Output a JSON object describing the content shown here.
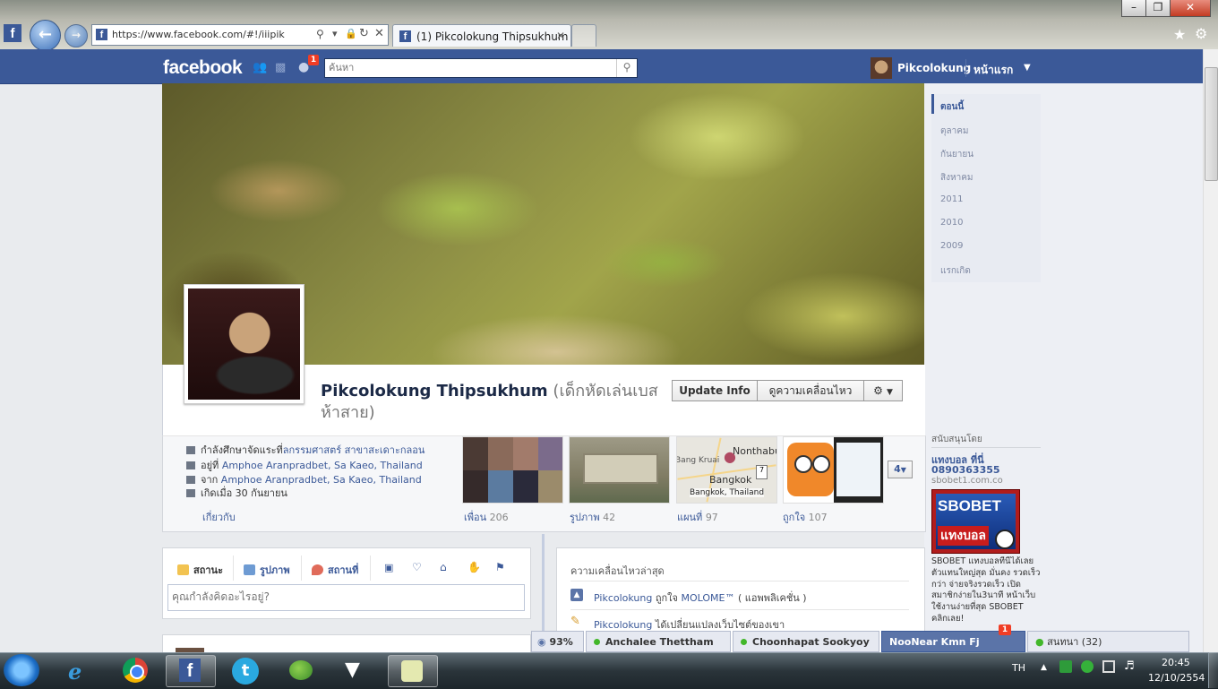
{
  "browser": {
    "address": "https://www.facebook.com/#!/iiipik",
    "tab_title": "(1) Pikcolokung Thipsukhum"
  },
  "topbar": {
    "logo": "facebook",
    "notification_count": "1",
    "search_placeholder": "ค้นหา",
    "user_name": "Pikcolokung",
    "home_label": "หน้าแรก"
  },
  "profile": {
    "name": "Pikcolokung Thipsukhum",
    "nickname": "(เด็กหัดเล่นเบสห้าสาย)",
    "update_info_label": "Update Info",
    "activity_label": "ดูความเคลื่อนไหว"
  },
  "info": {
    "study": "กำลังศึกษาจัดแระที่",
    "study_link": "ลกรรมศาสตร์ สาขาสะเดาะกลอน",
    "lives_prefix": "อยู่ที่",
    "lives": "Amphoe Aranpradbet, Sa Kaeo, Thailand",
    "from_prefix": "จาก",
    "from": "Amphoe Aranpradbet, Sa Kaeo, Thailand",
    "birthday": "เกิดเมื่อ 30 กันยายน",
    "about_link": "เกี่ยวกับ"
  },
  "tiles": [
    {
      "label": "เพื่อน",
      "count": "206"
    },
    {
      "label": "รูปภาพ",
      "count": "42"
    },
    {
      "label": "แผนที่",
      "count": "97"
    },
    {
      "label": "ถูกใจ",
      "count": "107"
    }
  ],
  "map_tile": {
    "city1": "Nonthabu",
    "city2": "Bang Kruai",
    "city3": "Bangkok",
    "caption": "Bangkok, Thailand",
    "route": "7"
  },
  "more_tiles": "4",
  "composer": {
    "tab_status": "สถานะ",
    "tab_photo": "รูปภาพ",
    "tab_place": "สถานที่",
    "placeholder": "คุณกำลังคิดอะไรอยู่?"
  },
  "recent_activity": {
    "title": "ความเคลื่อนไหวล่าสุด",
    "line1_user": "Pikcolokung",
    "line1_text": "ถูกใจ",
    "line1_link": "MOLOME™",
    "line1_suffix": "( แอพพลิเคชั่น )",
    "line2_user": "Pikcolokung",
    "line2_text": "ได้เปลี่ยนแปลงเว็บไซต์ของเขา"
  },
  "year_nav": [
    "ตอนนี้",
    "ตุลาคม",
    "กันยายน",
    "สิงหาคม",
    "2011",
    "2010",
    "2009",
    "แรกเกิด"
  ],
  "ads": {
    "heading": "สนับสนุนโดย",
    "title": "แทงบอล ที่นี่",
    "phone": "0890363355",
    "domain": "sbobet1.com.co",
    "image_top": "SBOBET",
    "image_bottom": "แทงบอล",
    "body": "SBOBET แทงบอลที่นี่ได้เลย ตัวแทนใหญ่สุด มั่นคง รวดเร็วกว่า จ่ายจริงรวดเร็ว เปิดสมาชิกง่ายใน3นาที หน้าเว็บใช้งานง่ายที่สุด SBOBET คลิกเลย!"
  },
  "chat": {
    "zoom": "93%",
    "friend1": "Anchalee Thettham",
    "friend2": "Choonhapat Sookyoy",
    "active_chat": "NooNear Kmn Fj",
    "active_badge": "1",
    "chat_label": "สนทนา",
    "online_count": "(32)"
  },
  "taskbar": {
    "lang": "TH",
    "time": "20:45",
    "date": "12/10/2554"
  }
}
